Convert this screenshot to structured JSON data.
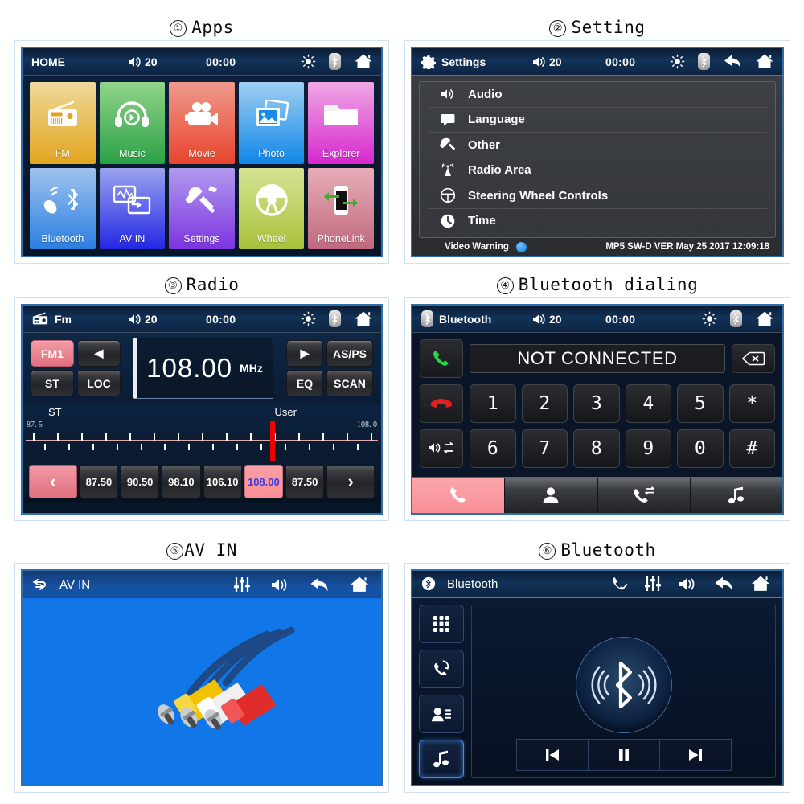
{
  "panels": [
    {
      "number": "①",
      "title": "Apps",
      "screen": {
        "statusbar": {
          "title": "HOME",
          "volume": "20",
          "clock": "00:00",
          "icons": [
            "brightness-icon",
            "bluetooth-icon",
            "home-icon"
          ]
        },
        "tiles": [
          {
            "label": "FM",
            "icon": "radio-icon",
            "c1": "#efd99a",
            "c2": "#e2a41e"
          },
          {
            "label": "Music",
            "icon": "headphones-icon",
            "c1": "#92d48a",
            "c2": "#2aa146"
          },
          {
            "label": "Movie",
            "icon": "camcorder-icon",
            "c1": "#ef9a8d",
            "c2": "#e8442c"
          },
          {
            "label": "Photo",
            "icon": "photo-icon",
            "c1": "#9fd0f2",
            "c2": "#0f86e8"
          },
          {
            "label": "Explorer",
            "icon": "folder-icon",
            "c1": "#efa8e4",
            "c2": "#d628cf"
          },
          {
            "label": "Bluetooth",
            "icon": "bt-phone-icon",
            "c1": "#9fc2ee",
            "c2": "#2a7fe0"
          },
          {
            "label": "AV IN",
            "icon": "av-in-icon",
            "c1": "#9aa3ef",
            "c2": "#2427e3"
          },
          {
            "label": "Settings",
            "icon": "tools-icon",
            "c1": "#b09aee",
            "c2": "#7d34e0"
          },
          {
            "label": "Wheel",
            "icon": "wheel-icon",
            "c1": "#d6e394",
            "c2": "#a8c23a"
          },
          {
            "label": "PhoneLink",
            "icon": "phonelink-icon",
            "c1": "#e7adb8",
            "c2": "#c0697f"
          }
        ]
      }
    },
    {
      "number": "②",
      "title": "Setting",
      "screen": {
        "statusbar": {
          "title": "Settings",
          "volume": "20",
          "clock": "00:00",
          "icons": [
            "brightness-icon",
            "bluetooth-icon",
            "back-icon",
            "home-icon"
          ]
        },
        "menu": [
          {
            "label": "Audio",
            "icon": "speaker-icon"
          },
          {
            "label": "Language",
            "icon": "chat-icon"
          },
          {
            "label": "Other",
            "icon": "wrench-icon"
          },
          {
            "label": "Radio Area",
            "icon": "antenna-icon"
          },
          {
            "label": "Steering Wheel Controls",
            "icon": "steering-wheel-icon"
          },
          {
            "label": "Time",
            "icon": "clock-icon"
          }
        ],
        "footer": {
          "video_warning_label": "Video Warning",
          "version": "MP5 SW-D VER May 25 2017 12:09:18"
        }
      }
    },
    {
      "number": "③",
      "title": "Radio",
      "screen": {
        "statusbar": {
          "title": "Fm",
          "volume": "20",
          "clock": "00:00",
          "icons": [
            "brightness-icon",
            "bluetooth-icon",
            "home-icon"
          ]
        },
        "band": "FM1",
        "buttons": {
          "prev": "◀",
          "next": "▶",
          "st": "ST",
          "loc": "LOC",
          "asps": "AS/PS",
          "eq": "EQ",
          "scan": "SCAN"
        },
        "frequency": "108.00",
        "unit": "MHz",
        "scale": {
          "left_label": "ST",
          "right_label": "User",
          "min": "87. 5",
          "max": "108. 0",
          "cursor_pct": 69
        },
        "presets": [
          "87.50",
          "90.50",
          "98.10",
          "106.10",
          "108.00",
          "87.50"
        ],
        "active_preset_index": 4,
        "nav": {
          "left": "‹",
          "right": "›"
        }
      }
    },
    {
      "number": "④",
      "title": "Bluetooth dialing",
      "screen": {
        "statusbar": {
          "title": "Bluetooth",
          "volume": "20",
          "clock": "00:00",
          "icons": [
            "brightness-icon",
            "bluetooth-icon",
            "home-icon"
          ]
        },
        "display": "NOT CONNECTED",
        "side_buttons": [
          "call-answer-icon",
          "call-end-icon",
          "audio-transfer-icon"
        ],
        "backspace_icon": "backspace-icon",
        "keys_row1": [
          "1",
          "2",
          "3",
          "4",
          "5",
          "*"
        ],
        "keys_row2": [
          "6",
          "7",
          "8",
          "9",
          "0",
          "#"
        ],
        "tabs": [
          {
            "icon": "dialpad-phone-icon",
            "active": true
          },
          {
            "icon": "contacts-icon",
            "active": false
          },
          {
            "icon": "call-history-icon",
            "active": false
          },
          {
            "icon": "music-note-icon",
            "active": false
          }
        ]
      }
    },
    {
      "number": "⑤",
      "title": "AV IN",
      "screen": {
        "statusbar": {
          "title": "AV IN",
          "icons": [
            "equalizer-icon",
            "speaker-icon",
            "back-icon",
            "home-icon"
          ]
        },
        "content_icon": "rca-cables-image"
      }
    },
    {
      "number": "⑥",
      "title": "Bluetooth",
      "screen": {
        "statusbar": {
          "title": "Bluetooth",
          "icons": [
            "phone-check-icon",
            "equalizer-icon",
            "speaker-icon",
            "back-icon",
            "home-icon"
          ]
        },
        "rail": [
          {
            "icon": "dialpad-icon",
            "active": false
          },
          {
            "icon": "phone-sync-icon",
            "active": false
          },
          {
            "icon": "contact-card-icon",
            "active": false
          },
          {
            "icon": "music-note-icon",
            "active": true
          }
        ],
        "center_icon": "bluetooth-orb-icon",
        "transport": [
          "prev-track-icon",
          "pause-icon",
          "next-track-icon"
        ]
      }
    }
  ]
}
